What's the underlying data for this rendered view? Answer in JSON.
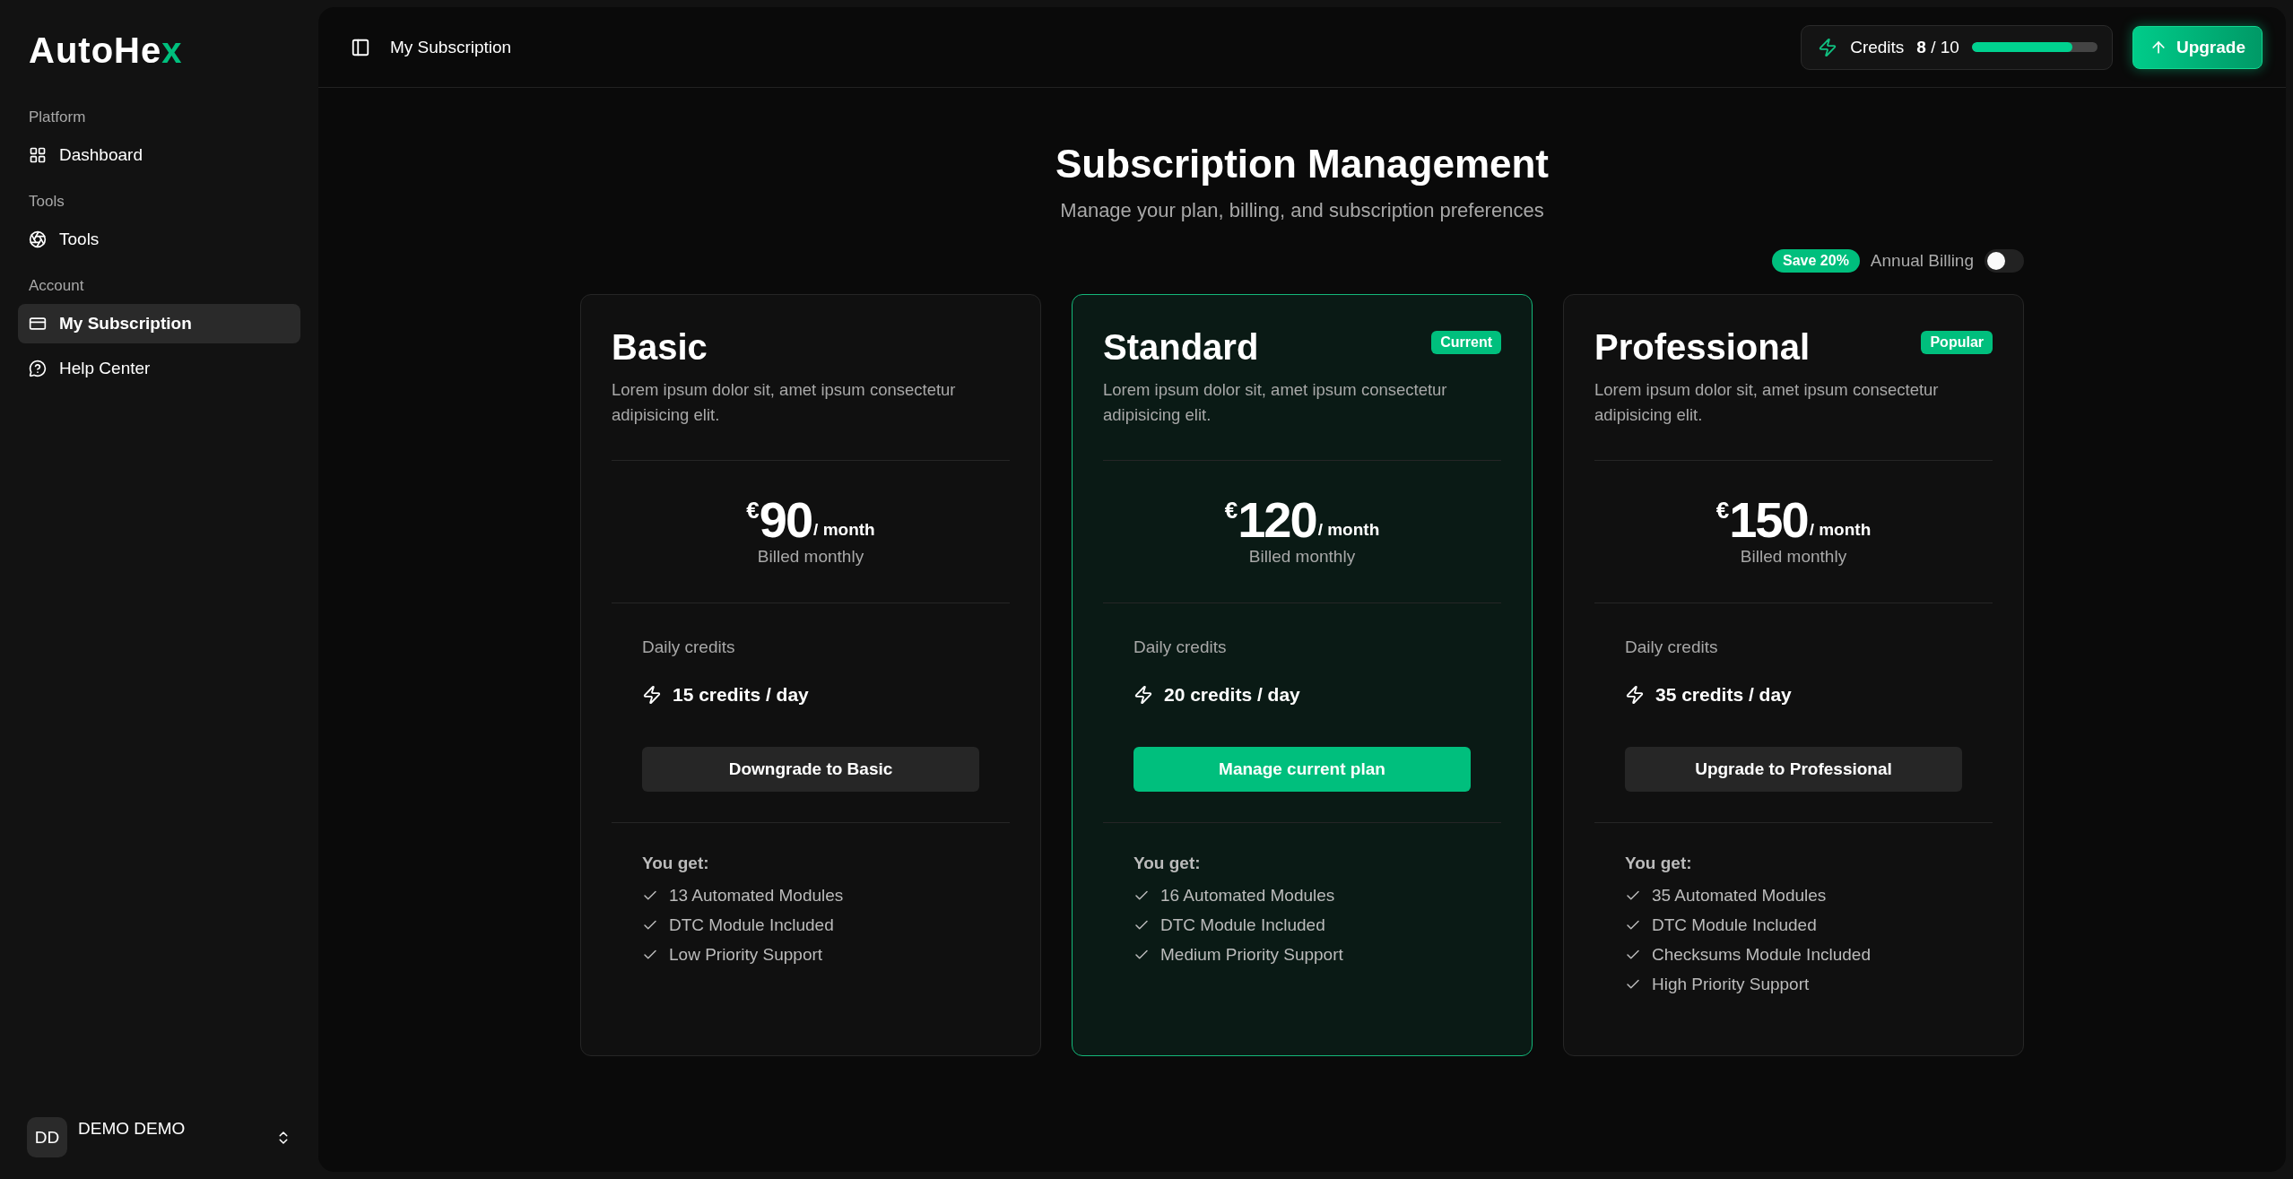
{
  "sidebar": {
    "logo": {
      "text": "AutoHe",
      "accent": "x"
    },
    "groups": [
      {
        "label": "Platform",
        "items": [
          {
            "label": "Dashboard",
            "selected": false
          }
        ]
      },
      {
        "label": "Tools",
        "items": [
          {
            "label": "Tools",
            "selected": false
          }
        ]
      },
      {
        "label": "Account",
        "items": [
          {
            "label": "My Subscription",
            "selected": true
          },
          {
            "label": "Help Center",
            "selected": false
          }
        ]
      }
    ],
    "user": {
      "initials": "DD",
      "name": "DEMO DEMO"
    }
  },
  "header": {
    "breadcrumb": "My Subscription",
    "credits": {
      "label": "Credits",
      "used": "8",
      "total": "/ 10",
      "level": 0.8
    },
    "upgrade_button": "Upgrade"
  },
  "page": {
    "title": "Subscription Management",
    "subtitle": "Manage your plan, billing, and subscription preferences",
    "billing": {
      "badge": "Save 20%",
      "label": "Annual Billing",
      "on": false
    }
  },
  "plans": [
    {
      "name": "Basic",
      "selected": false,
      "description": "Lorem ipsum dolor sit, amet ipsum consectetur adipisicing elit.",
      "currency": "€",
      "amount": "90",
      "period": "/ month",
      "billing": "Billed monthly",
      "credits_label": "Daily credits",
      "credits": "15 credits / day",
      "button": "Downgrade to Basic",
      "features_title": "You get:",
      "features": [
        "13 Automated Modules",
        "DTC Module Included",
        "Low Priority Support"
      ]
    },
    {
      "name": "Standard",
      "badge": "Current",
      "selected": true,
      "description": "Lorem ipsum dolor sit, amet ipsum consectetur adipisicing elit.",
      "currency": "€",
      "amount": "120",
      "period": "/ month",
      "billing": "Billed monthly",
      "credits_label": "Daily credits",
      "credits": "20 credits / day",
      "button": "Manage current plan",
      "features_title": "You get:",
      "features": [
        "16 Automated Modules",
        "DTC Module Included",
        "Medium Priority Support"
      ]
    },
    {
      "name": "Professional",
      "badge": "Popular",
      "selected": false,
      "description": "Lorem ipsum dolor sit, amet ipsum consectetur adipisicing elit.",
      "currency": "€",
      "amount": "150",
      "period": "/ month",
      "billing": "Billed monthly",
      "credits_label": "Daily credits",
      "credits": "35 credits / day",
      "button": "Upgrade to Professional",
      "features_title": "You get:",
      "features": [
        "35 Automated Modules",
        "DTC Module Included",
        "Checksums Module Included",
        "High Priority Support"
      ]
    }
  ]
}
